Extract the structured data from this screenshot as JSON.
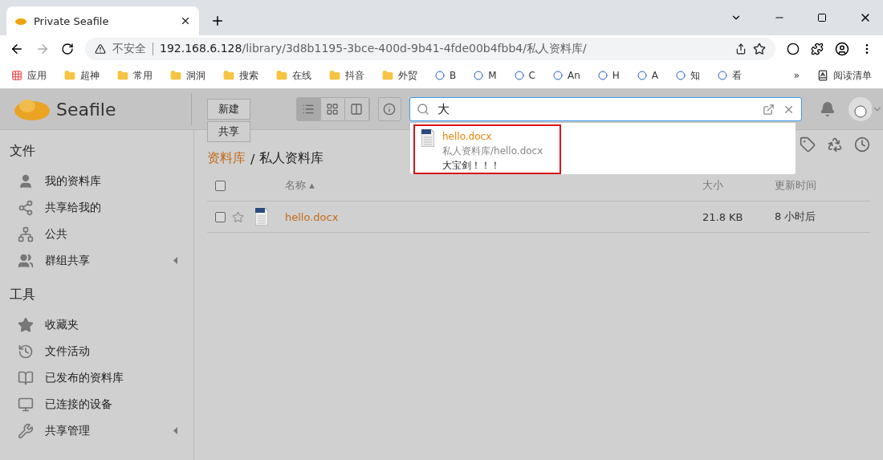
{
  "browser": {
    "tab_title": "Private Seafile",
    "security": "不安全",
    "url_host": "192.168.6.128",
    "url_path": "/library/3d8b1195-3bce-400d-9b41-4fde00b4fbb4/私人资料库/",
    "bookmarks": [
      {
        "label": "应用",
        "kind": "apps"
      },
      {
        "label": "超神",
        "kind": "folder"
      },
      {
        "label": "常用",
        "kind": "folder"
      },
      {
        "label": "洞洞",
        "kind": "folder"
      },
      {
        "label": "搜索",
        "kind": "folder"
      },
      {
        "label": "在线",
        "kind": "folder"
      },
      {
        "label": "抖音",
        "kind": "folder"
      },
      {
        "label": "外贸",
        "kind": "folder"
      },
      {
        "label": "B",
        "kind": "site"
      },
      {
        "label": "M",
        "kind": "site"
      },
      {
        "label": "C",
        "kind": "site"
      },
      {
        "label": "An",
        "kind": "site"
      },
      {
        "label": "H",
        "kind": "site"
      },
      {
        "label": "A",
        "kind": "site"
      },
      {
        "label": "知",
        "kind": "site"
      },
      {
        "label": "看",
        "kind": "site"
      }
    ],
    "more": "»",
    "reading_list": "阅读清单"
  },
  "app": {
    "logo": "Seafile",
    "menu_buttons": [
      "新建",
      "共享"
    ],
    "view_modes": [
      {
        "kind": "list",
        "selected": true
      },
      {
        "kind": "grid",
        "selected": false
      },
      {
        "kind": "columns",
        "selected": false
      }
    ],
    "search": {
      "value": "大",
      "results": [
        {
          "name": "hello.docx",
          "path": "私人资料库/hello.docx",
          "snippet": "大宝剑！！！"
        }
      ]
    },
    "sidebar": [
      {
        "heading": "文件",
        "items": [
          {
            "label": "我的资料库",
            "kind": "user",
            "expandable": false
          },
          {
            "label": "共享给我的",
            "kind": "share",
            "expandable": false
          },
          {
            "label": "公共",
            "kind": "org",
            "expandable": false
          },
          {
            "label": "群组共享",
            "kind": "group",
            "expandable": true
          }
        ]
      },
      {
        "heading": "工具",
        "items": [
          {
            "label": "收藏夹",
            "kind": "star",
            "expandable": false
          },
          {
            "label": "文件活动",
            "kind": "history",
            "expandable": false
          },
          {
            "label": "已发布的资料库",
            "kind": "book",
            "expandable": false
          },
          {
            "label": "已连接的设备",
            "kind": "monitor",
            "expandable": false
          },
          {
            "label": "共享管理",
            "kind": "wrench",
            "expandable": true
          }
        ]
      }
    ],
    "breadcrumb": {
      "parent": "资料库",
      "separator": "/",
      "current": "私人资料库"
    },
    "table": {
      "all_checked": false,
      "sort_mark": "▴",
      "columns": [
        "名称",
        "大小",
        "更新时间"
      ],
      "rows": [
        {
          "checked": false,
          "starred": false,
          "name": "hello.docx",
          "size": "21.8 KB",
          "modified": "8 小时后"
        }
      ]
    }
  }
}
